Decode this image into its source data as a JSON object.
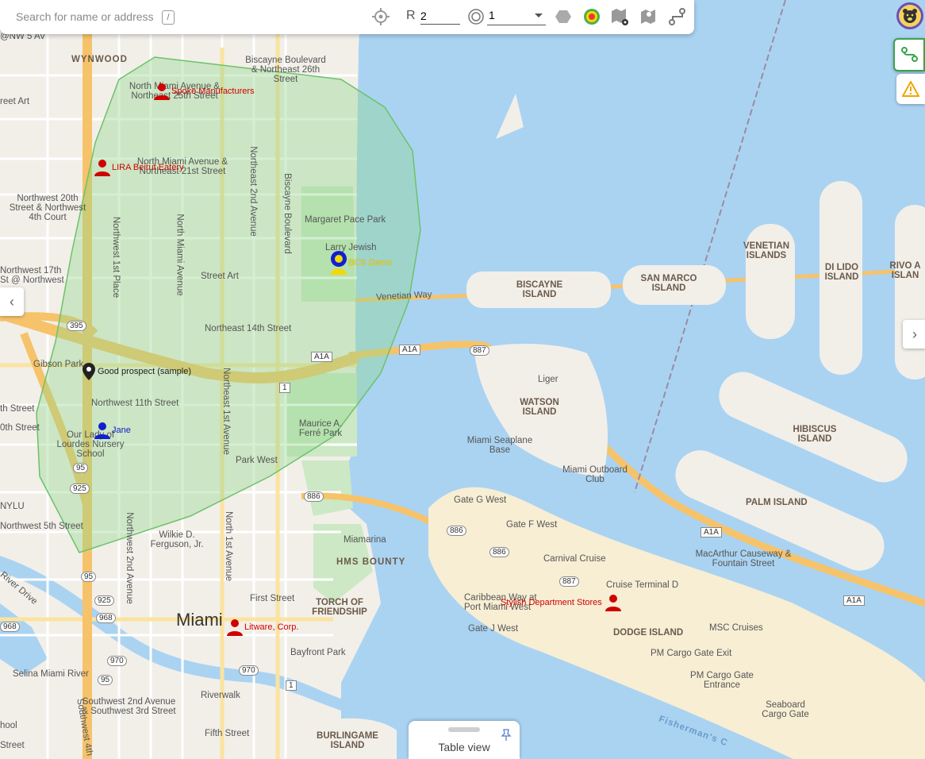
{
  "search": {
    "placeholder": "Search for name or address",
    "shortcut": "/"
  },
  "toolbar": {
    "radius_label": "R",
    "radius_value": "2",
    "ring_value": "1",
    "icons": [
      "crosshair-icon",
      "ring-icon",
      "hexagon-icon",
      "heatmap-icon",
      "map-settings-icon",
      "map-layers-icon",
      "route-icon"
    ]
  },
  "map_labels": {
    "wynwood": "WYNWOOD",
    "biscayne_blvd_26": "Biscayne Boulevard & Northeast 26th Street",
    "north_miami_ave_25": "North Miami Avenue & Northeast 25th Street",
    "north_miami_ave_21": "North Miami Avenue & Northeast 21st Street",
    "nw_20th": "Northwest 20th Street & Northwest 4th Court",
    "nw_17th": "Northwest 17th St @ Northwest",
    "margaret_pace": "Margaret Pace Park",
    "street_art": "Street Art",
    "venetian_way": "Venetian Way",
    "ne_14th": "Northeast 14th Street",
    "gibson_park": "Gibson Park",
    "nw_11th": "Northwest 11th Street",
    "our_lady": "Our Lady of Lourdes Nursery School",
    "maurice_ferre": "Maurice A. Ferré Park",
    "park_west": "Park West",
    "nw_5th": "Northwest 5th Street",
    "wilkie_ferguson": "Wilkie D. Ferguson, Jr.",
    "miamarina": "Miamarina",
    "hms_bounty": "HMS BOUNTY",
    "torch_friendship": "TORCH OF FRIENDSHIP",
    "first_street": "First Street",
    "miami": "Miami",
    "bayfront_park": "Bayfront Park",
    "selina": "Selina Miami River",
    "sw_2nd": "Southwest 2nd Avenue & Southwest 3rd Street",
    "riverwalk": "Riverwalk",
    "fifth_street": "Fifth Street",
    "burlingame": "BURLINGAME ISLAND",
    "biscayne_island": "BISCAYNE ISLAND",
    "san_marco": "SAN MARCO ISLAND",
    "venetian_islands": "VENETIAN ISLANDS",
    "di_lido": "DI LIDO ISLAND",
    "rivo_alto": "RIVO A ISLAN",
    "watson": "WATSON ISLAND",
    "liger": "Liger",
    "seaplane": "Miami Seaplane Base",
    "outboard": "Miami Outboard Club",
    "hibiscus": "HIBISCUS ISLAND",
    "palm": "PALM ISLAND",
    "macarthur": "MacArthur Causeway & Fountain Street",
    "gate_g": "Gate G West",
    "gate_f": "Gate F West",
    "carnival": "Carnival Cruise",
    "cruise_terminal": "Cruise Terminal D",
    "caribbean": "Caribbean Way at Port Miami West",
    "gate_j": "Gate J West",
    "dodge": "DODGE ISLAND",
    "msc": "MSC Cruises",
    "pm_cargo_exit": "PM Cargo Gate Exit",
    "pm_cargo_entrance": "PM Cargo Gate Entrance",
    "seaboard": "Seaboard Cargo Gate",
    "fishermans": "Fisherman's C",
    "nw5av": "@NW 5 AV",
    "reet_art": "reet Art",
    "nylu": "NYLU",
    "river_drive": "River Drive",
    "th_street": "th Street",
    "oth_street": "0th Street",
    "hool": "hool",
    "street_bottom": "Street",
    "north_miami_avenue": "North Miami Avenue",
    "ne_2nd_avenue": "Northeast 2nd Avenue",
    "biscayne_boulevard": "Biscayne Boulevard",
    "nw_1st_place": "Northwest 1st Place",
    "ne_1st_avenue": "Northeast 1st Avenue",
    "nw_2nd_avenue": "Northwest 2nd Avenue",
    "n_1st_avenue": "North 1st Avenue",
    "sw_4th": "Southwest 4th",
    "larry_jewish": "Larry Jewish"
  },
  "shields": [
    "395",
    "A1A",
    "887",
    "1",
    "95",
    "925",
    "886",
    "968",
    "970",
    "A1A"
  ],
  "markers": [
    {
      "label": "Spoke Manufacturers",
      "type": "person",
      "color": "#d00000"
    },
    {
      "label": "LIRA Beirut Eatery",
      "type": "person",
      "color": "#d00000"
    },
    {
      "label": "BCS Demo",
      "type": "person-ring",
      "color": "#f5d800"
    },
    {
      "label": "Good prospect (sample)",
      "type": "pin",
      "color": "#222222"
    },
    {
      "label": "Jane",
      "type": "person",
      "color": "#1020d0"
    },
    {
      "label": "Litware, Corp.",
      "type": "person",
      "color": "#d00000"
    },
    {
      "label": "Stylish Department Stores",
      "type": "person",
      "color": "#d00000"
    }
  ],
  "table_view": {
    "label": "Table view"
  },
  "colors": {
    "water": "#aad3f2",
    "land": "#f2efe9",
    "polygon_fill": "#8fd48a",
    "polygon_stroke": "#6cc26a",
    "highway": "#f6c36a"
  }
}
